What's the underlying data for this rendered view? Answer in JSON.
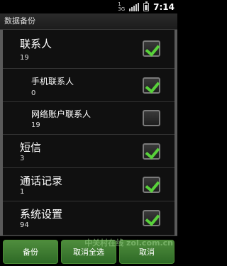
{
  "status_bar": {
    "network_labels": [
      "1",
      "3G"
    ],
    "time": "7:14"
  },
  "title": "数据备份",
  "list": {
    "contacts": {
      "label": "联系人",
      "count": "19",
      "checked": true
    },
    "phone_contacts": {
      "label": "手机联系人",
      "count": "0",
      "checked": true
    },
    "network_contacts": {
      "label": "网络账户联系人",
      "count": "19",
      "checked": false
    },
    "sms": {
      "label": "短信",
      "count": "3",
      "checked": true
    },
    "call_log": {
      "label": "通话记录",
      "count": "1",
      "checked": true
    },
    "system_settings": {
      "label": "系统设置",
      "count": "94",
      "checked": true
    }
  },
  "buttons": {
    "backup": "备份",
    "deselect_all": "取消全选",
    "cancel": "取消"
  },
  "watermark": "中关村在线 zol.com.cn",
  "colors": {
    "check_green": "#58d13a",
    "button_green": "#3f7d33"
  }
}
